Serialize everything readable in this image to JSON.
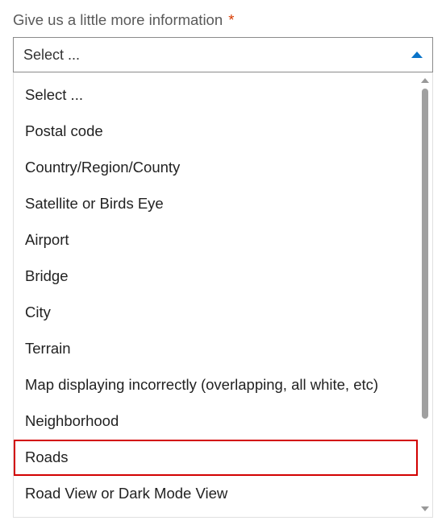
{
  "field": {
    "label": "Give us a little more information",
    "required_mark": "*"
  },
  "select": {
    "current_text": "Select ..."
  },
  "dropdown": {
    "options": [
      {
        "label": "Select ...",
        "highlighted": false
      },
      {
        "label": "Postal code",
        "highlighted": false
      },
      {
        "label": "Country/Region/County",
        "highlighted": false
      },
      {
        "label": "Satellite or Birds Eye",
        "highlighted": false
      },
      {
        "label": "Airport",
        "highlighted": false
      },
      {
        "label": "Bridge",
        "highlighted": false
      },
      {
        "label": "City",
        "highlighted": false
      },
      {
        "label": "Terrain",
        "highlighted": false
      },
      {
        "label": "Map displaying incorrectly (overlapping, all white, etc)",
        "highlighted": false
      },
      {
        "label": "Neighborhood",
        "highlighted": false
      },
      {
        "label": "Roads",
        "highlighted": true
      },
      {
        "label": "Road View or Dark Mode View",
        "highlighted": false
      }
    ]
  }
}
